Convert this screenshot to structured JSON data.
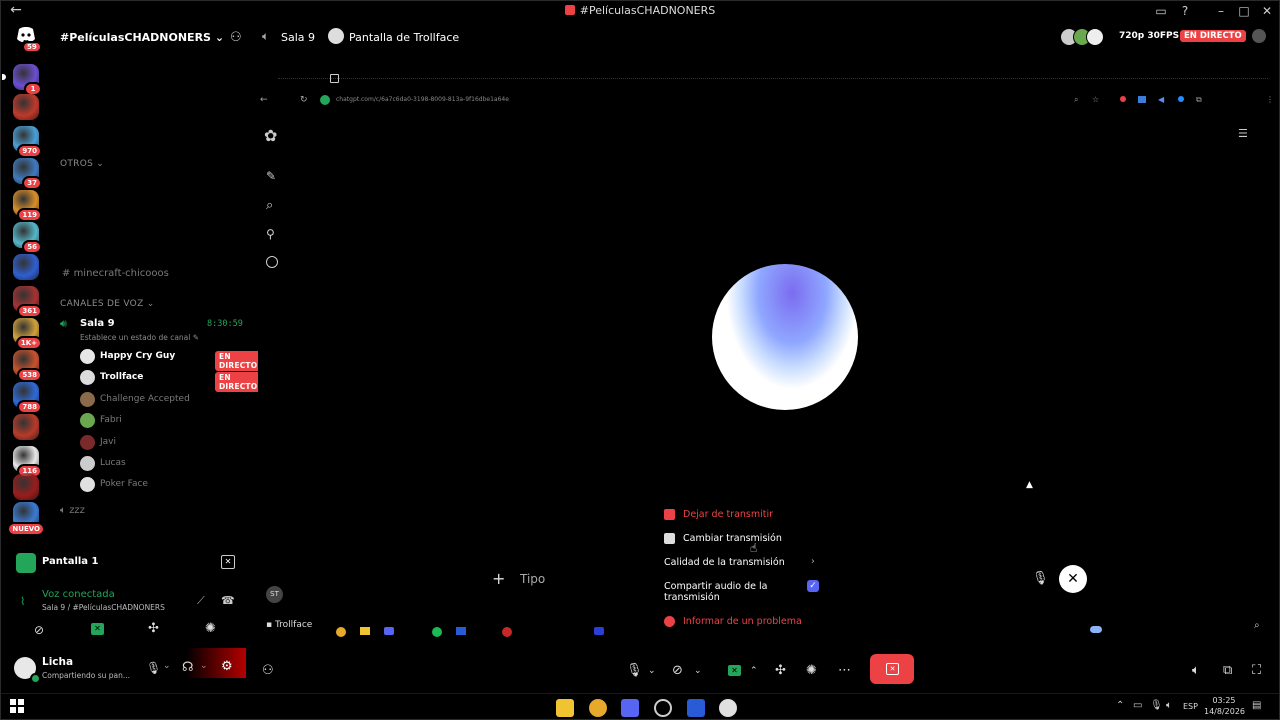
{
  "window": {
    "title": "#PelículasCHADNONERS"
  },
  "server": {
    "name": "#PelículasCHADNONERS",
    "dm_badge": "59"
  },
  "rail": [
    {
      "badge": "1",
      "color": "#6b4fd1",
      "active": true
    },
    {
      "badge": "",
      "color": "#c0392b"
    },
    {
      "badge": "970",
      "color": "#4aa0d8"
    },
    {
      "badge": "37",
      "color": "#3e7bbf"
    },
    {
      "badge": "119",
      "color": "#d98e2a"
    },
    {
      "badge": "56",
      "color": "#55b6c8"
    },
    {
      "badge": "",
      "color": "#2f5fd0"
    },
    {
      "badge": "361",
      "color": "#a63232"
    },
    {
      "badge": "1K+",
      "color": "#d1a13a"
    },
    {
      "badge": "538",
      "color": "#c9522d"
    },
    {
      "badge": "788",
      "color": "#2d6ad9"
    },
    {
      "badge": "",
      "color": "#b83a2a"
    },
    {
      "badge": "116",
      "color": "#e8e8e8"
    },
    {
      "badge": "",
      "color": "#9b1c1c"
    },
    {
      "badge": "NUEVO",
      "color": "#3a7bd5"
    }
  ],
  "sidebar": {
    "cat_otros": "OTROS",
    "text_channel": "minecraft-chicooos",
    "cat_voice": "CANALES DE VOZ",
    "voice_channel": {
      "name": "Sala 9",
      "timer": "8:30:59",
      "status": "Establece un estado de canal"
    },
    "users": [
      {
        "name": "Happy Cry Guy",
        "live": "EN DIRECTO",
        "bright": true,
        "color": "#e6e6e6"
      },
      {
        "name": "Trollface",
        "live": "EN DIRECTO",
        "bright": true,
        "color": "#dcdcdc"
      },
      {
        "name": "Challenge Accepted",
        "live": "",
        "bright": false,
        "color": "#8a6a4a"
      },
      {
        "name": "Fabri",
        "live": "",
        "bright": false,
        "color": "#6aa84f"
      },
      {
        "name": "Javi",
        "live": "",
        "bright": false,
        "color": "#7a2a2a"
      },
      {
        "name": "Lucas",
        "live": "",
        "bright": false,
        "color": "#cccccc"
      },
      {
        "name": "Poker Face",
        "live": "",
        "bright": false,
        "color": "#e0e0e0"
      }
    ],
    "other_voice": "zzz"
  },
  "screen_panel": {
    "title": "Pantalla 1",
    "voice_status": "Voz conectada",
    "voice_path": "Sala 9 / #PelículasCHADNONERS"
  },
  "user_panel": {
    "name": "Licha",
    "status": "Compartiendo su pan..."
  },
  "header": {
    "voice": "Sala 9",
    "screen": "Pantalla de Trollface",
    "quality": "720p 30FPS",
    "live": "EN DIRECTO"
  },
  "browser": {
    "url": "chatgpt.com/c/6a7c6da0-3198-8009-813a-9f16dbe1a64e"
  },
  "stream": {
    "composer_placeholder": "Tipo",
    "user_initials": "ST",
    "taskbar_label": "Trollface"
  },
  "menu": {
    "stop": "Dejar de transmitir",
    "change": "Cambiar transmisión",
    "quality": "Calidad de la transmisión",
    "share_audio": "Compartir audio de la transmisión",
    "report": "Informar de un problema"
  },
  "taskbar": {
    "time": "03:25",
    "date": "14/8/2026",
    "lang": "ESP"
  },
  "colors": {
    "live_red": "#ed4245",
    "online_green": "#23a55a",
    "accent_blue": "#5865f2"
  }
}
